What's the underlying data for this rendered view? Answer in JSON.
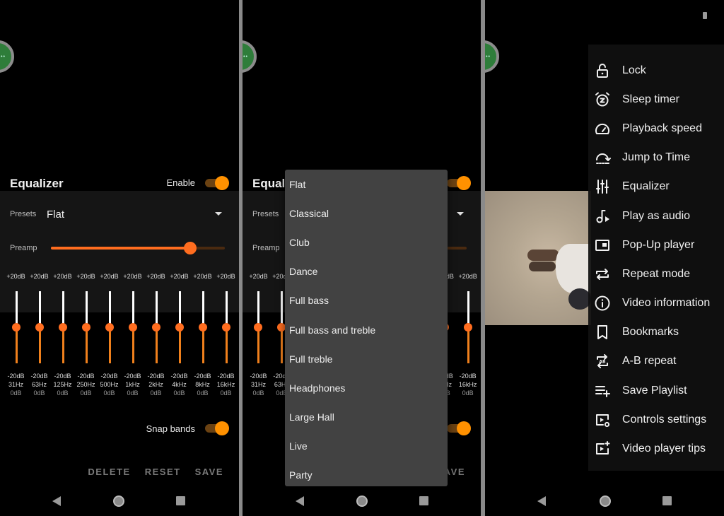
{
  "equalizer": {
    "title": "Equalizer",
    "enable_label": "Enable",
    "enabled": true,
    "presets_label": "Presets",
    "preset_value": "Flat",
    "preamp_label": "Preamp",
    "preamp_level": 0.8,
    "snap_label": "Snap bands",
    "snap_enabled": true,
    "bands": [
      {
        "max": "+20dB",
        "min": "-20dB",
        "freq": "31Hz",
        "gain": "0dB"
      },
      {
        "max": "+20dB",
        "min": "-20dB",
        "freq": "63Hz",
        "gain": "0dB"
      },
      {
        "max": "+20dB",
        "min": "-20dB",
        "freq": "125Hz",
        "gain": "0dB"
      },
      {
        "max": "+20dB",
        "min": "-20dB",
        "freq": "250Hz",
        "gain": "0dB"
      },
      {
        "max": "+20dB",
        "min": "-20dB",
        "freq": "500Hz",
        "gain": "0dB"
      },
      {
        "max": "+20dB",
        "min": "-20dB",
        "freq": "1kHz",
        "gain": "0dB"
      },
      {
        "max": "+20dB",
        "min": "-20dB",
        "freq": "2kHz",
        "gain": "0dB"
      },
      {
        "max": "+20dB",
        "min": "-20dB",
        "freq": "4kHz",
        "gain": "0dB"
      },
      {
        "max": "+20dB",
        "min": "-20dB",
        "freq": "8kHz",
        "gain": "0dB"
      },
      {
        "max": "+20dB",
        "min": "-20dB",
        "freq": "16kHz",
        "gain": "0dB"
      }
    ],
    "actions": {
      "delete": "DELETE",
      "reset": "RESET",
      "save": "SAVE"
    }
  },
  "preset_dropdown": {
    "options": [
      "Flat",
      "Classical",
      "Club",
      "Dance",
      "Full bass",
      "Full bass and treble",
      "Full treble",
      "Headphones",
      "Large Hall",
      "Live",
      "Party"
    ]
  },
  "more_menu": {
    "items": [
      {
        "label": "Lock",
        "icon": "lock-open-icon"
      },
      {
        "label": "Sleep timer",
        "icon": "alarm-z-icon"
      },
      {
        "label": "Playback speed",
        "icon": "speedometer-icon"
      },
      {
        "label": "Jump to Time",
        "icon": "jump-time-icon"
      },
      {
        "label": "Equalizer",
        "icon": "equalizer-icon"
      },
      {
        "label": "Play as audio",
        "icon": "music-play-icon"
      },
      {
        "label": "Pop-Up player",
        "icon": "picture-in-picture-icon"
      },
      {
        "label": "Repeat mode",
        "icon": "repeat-icon"
      },
      {
        "label": "Video information",
        "icon": "info-icon"
      },
      {
        "label": "Bookmarks",
        "icon": "bookmark-icon"
      },
      {
        "label": "A-B repeat",
        "icon": "ab-repeat-icon"
      },
      {
        "label": "Save Playlist",
        "icon": "playlist-add-icon"
      },
      {
        "label": "Controls settings",
        "icon": "controls-settings-icon"
      },
      {
        "label": "Video player tips",
        "icon": "video-tips-icon"
      }
    ]
  },
  "colors": {
    "accent": "#ff6d1f",
    "toggle_on": "#ff9100",
    "fab": "#2e7d3a",
    "popup_bg": "#424242"
  }
}
